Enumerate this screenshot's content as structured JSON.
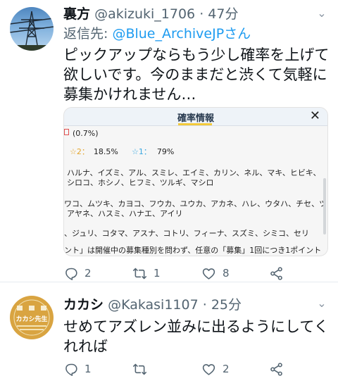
{
  "tweets": [
    {
      "name": "裏方",
      "handle": "@akizuki_1706",
      "time": "· 47分",
      "reply_prefix": "返信先: ",
      "reply_handle": "@Blue_ArchiveJPさん",
      "text": "ピックアップならもう少し確率を上げて欲しいです。今のままだと渋くて気軽に募集かけれません…",
      "media": {
        "title": "確率情報",
        "rate_line": "(0.7%)",
        "star2_label": "☆2：",
        "star2_value": "18.5%",
        "star1_label": "☆1：",
        "star1_value": "79%",
        "list_lines": [
          "ハルナ、イズミ、アル、スミレ、エイミ、カリン、ネル、マキ、ヒビキ、",
          "シロコ、ホシノ、ヒフミ、ツルギ、マシロ",
          "ワコ、ムツキ、カヨコ、フウカ、ユウカ、アカネ、ハレ、ウタハ、チセ、ツ",
          "アヤネ、ハスミ、ハナエ、アイリ",
          "、ジュリ、コタマ、アスナ、コトリ、フィーナ、スズミ、シミコ、セリ",
          "ント」は開催中の募集種別を問わず、任意の「募集」1回につき1ポイント"
        ]
      },
      "actions": {
        "reply": "2",
        "retweet": "1",
        "like": "8"
      }
    },
    {
      "name": "カカシ",
      "handle": "@Kakasi1107",
      "time": "· 25分",
      "text": "せめてアズレン並みに出るようにしてくれれば",
      "avatar_text": "カカシ先生",
      "actions": {
        "reply": "1",
        "retweet": "",
        "like": "2"
      }
    }
  ]
}
